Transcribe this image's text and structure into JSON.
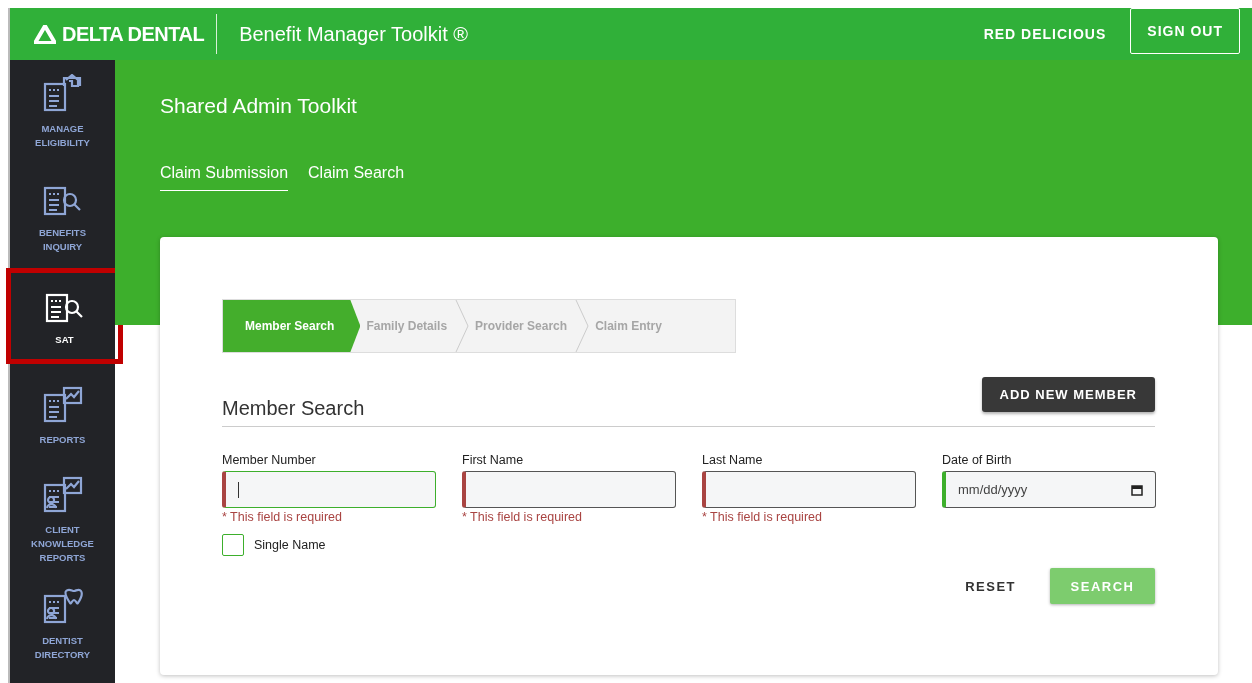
{
  "header": {
    "logo": "DELTA DENTAL",
    "app_title": "Benefit Manager Toolkit ®",
    "user": "RED DELICIOUS",
    "sign_out": "SIGN OUT"
  },
  "sidebar": {
    "items": [
      {
        "label": "MANAGE ELIGIBILITY",
        "kind": "house",
        "selected": false
      },
      {
        "label": "BENEFITS INQUIRY",
        "kind": "search",
        "selected": false
      },
      {
        "label": "SAT",
        "kind": "search",
        "selected": true
      },
      {
        "label": "REPORTS",
        "kind": "chart",
        "selected": false
      },
      {
        "label": "CLIENT KNOWLEDGE REPORTS",
        "kind": "person-chart",
        "selected": false
      },
      {
        "label": "DENTIST DIRECTORY",
        "kind": "person-tooth",
        "selected": false
      }
    ]
  },
  "page_title": "Shared Admin Toolkit",
  "tabs": [
    {
      "label": "Claim Submission",
      "selected": true
    },
    {
      "label": "Claim Search",
      "selected": false
    }
  ],
  "steps": [
    {
      "label": "Member Search",
      "selected": true
    },
    {
      "label": "Family Details",
      "selected": false
    },
    {
      "label": "Provider Search",
      "selected": false
    },
    {
      "label": "Claim Entry",
      "selected": false
    }
  ],
  "section_title": "Member Search",
  "add_button": "ADD NEW MEMBER",
  "fields": [
    {
      "label": "Member Number",
      "kind": "text",
      "invalid": true,
      "focused": true,
      "error": "* This field is required"
    },
    {
      "label": "First Name",
      "kind": "text",
      "invalid": true,
      "focused": false,
      "error": "* This field is required"
    },
    {
      "label": "Last Name",
      "kind": "text",
      "invalid": true,
      "focused": false,
      "error": "* This field is required"
    },
    {
      "label": "Date of Birth",
      "kind": "date",
      "invalid": false,
      "focused": false,
      "placeholder": "mm/dd/yyyy"
    }
  ],
  "single_name": {
    "label": "Single Name",
    "checked": false
  },
  "reset": "RESET",
  "search": {
    "label": "SEARCH",
    "disabled": true
  }
}
